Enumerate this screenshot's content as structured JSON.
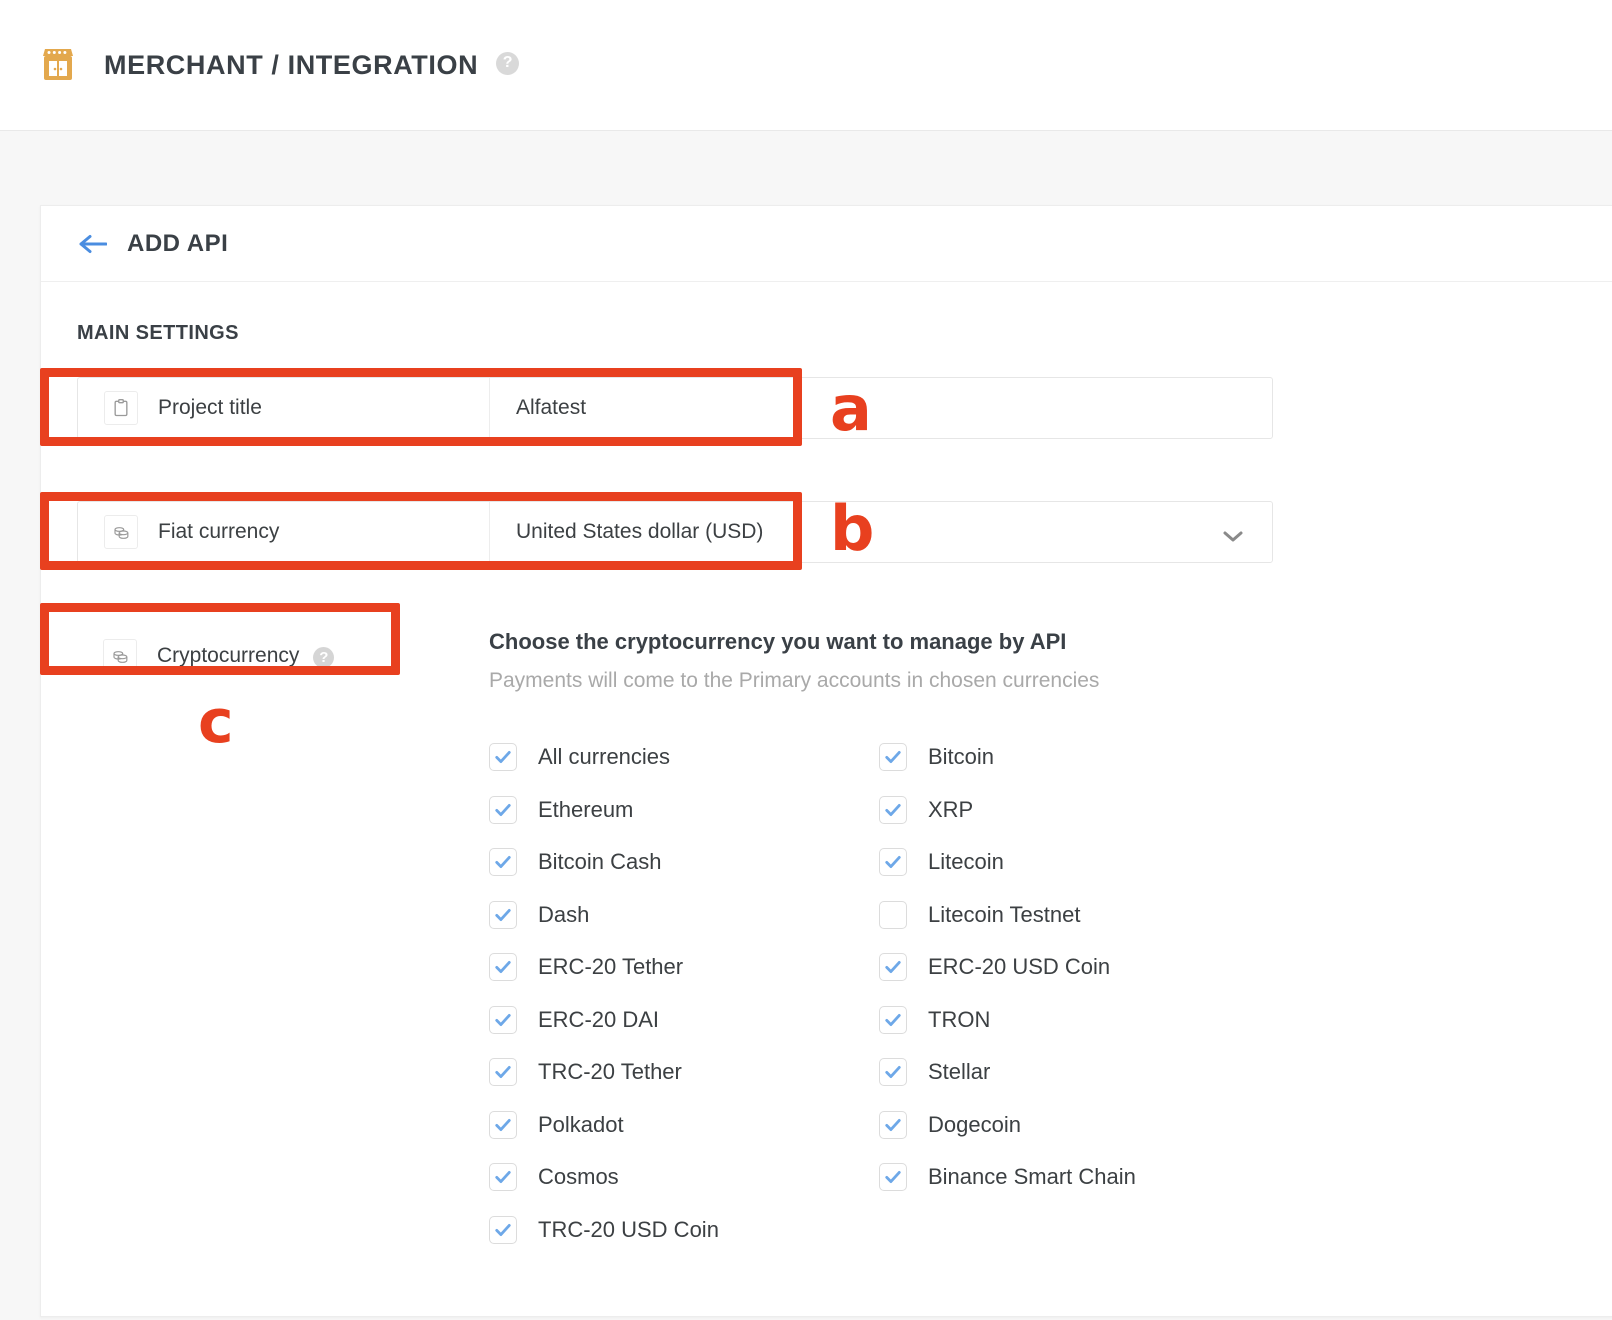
{
  "header": {
    "icon": "store-icon",
    "title": "MERCHANT / INTEGRATION",
    "help_glyph": "?"
  },
  "card": {
    "back_icon": "arrow-left-icon",
    "title": "ADD API",
    "section_label": "MAIN SETTINGS"
  },
  "fields": {
    "project_title": {
      "icon": "clipboard-icon",
      "label": "Project title",
      "value": "Alfatest",
      "placeholder": "Project title"
    },
    "fiat_currency": {
      "icon": "coins-icon",
      "label": "Fiat currency",
      "value": "United States dollar (USD)",
      "chevron": "chevron-down-icon"
    },
    "cryptocurrency": {
      "icon": "coins-icon",
      "label": "Cryptocurrency",
      "help_glyph": "?",
      "heading": "Choose the cryptocurrency you want to manage by API",
      "subtext": "Payments will come to the Primary accounts in chosen currencies"
    }
  },
  "crypto_options": {
    "left_column": [
      {
        "label": "All currencies",
        "checked": true
      },
      {
        "label": "Ethereum",
        "checked": true
      },
      {
        "label": "Bitcoin Cash",
        "checked": true
      },
      {
        "label": "Dash",
        "checked": true
      },
      {
        "label": "ERC-20 Tether",
        "checked": true
      },
      {
        "label": "ERC-20 DAI",
        "checked": true
      },
      {
        "label": "TRC-20 Tether",
        "checked": true
      },
      {
        "label": "Polkadot",
        "checked": true
      },
      {
        "label": "Cosmos",
        "checked": true
      },
      {
        "label": "TRC-20 USD Coin",
        "checked": true
      }
    ],
    "right_column": [
      {
        "label": "Bitcoin",
        "checked": true
      },
      {
        "label": "XRP",
        "checked": true
      },
      {
        "label": "Litecoin",
        "checked": true
      },
      {
        "label": "Litecoin Testnet",
        "checked": false
      },
      {
        "label": "ERC-20 USD Coin",
        "checked": true
      },
      {
        "label": "TRON",
        "checked": true
      },
      {
        "label": "Stellar",
        "checked": true
      },
      {
        "label": "Dogecoin",
        "checked": true
      },
      {
        "label": "Binance Smart Chain",
        "checked": true
      }
    ]
  },
  "annotations": {
    "color": "#e8401f",
    "labels": [
      {
        "id": "a",
        "text": "a"
      },
      {
        "id": "b",
        "text": "b"
      },
      {
        "id": "c",
        "text": "c"
      }
    ]
  },
  "colors": {
    "accent_red": "#e8401f",
    "checkbox_blue": "#6ea8e8",
    "link_blue": "#4a8de0",
    "store_orange": "#e3a84d"
  }
}
